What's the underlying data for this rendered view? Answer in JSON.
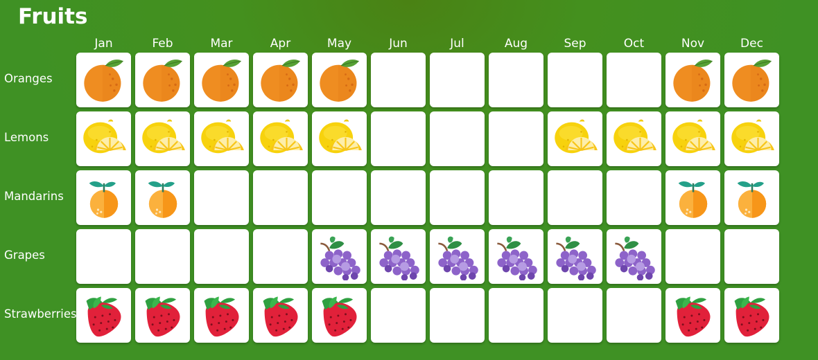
{
  "title": "Fruits",
  "months": [
    "Jan",
    "Feb",
    "Mar",
    "Apr",
    "May",
    "Jun",
    "Jul",
    "Aug",
    "Sep",
    "Oct",
    "Nov",
    "Dec"
  ],
  "fruits": [
    {
      "name": "Oranges",
      "icon": "orange-icon",
      "availability": [
        true,
        true,
        true,
        true,
        true,
        false,
        false,
        false,
        false,
        false,
        true,
        true
      ]
    },
    {
      "name": "Lemons",
      "icon": "lemon-icon",
      "availability": [
        true,
        true,
        true,
        true,
        true,
        false,
        false,
        false,
        true,
        true,
        true,
        true
      ]
    },
    {
      "name": "Mandarins",
      "icon": "mandarin-icon",
      "availability": [
        true,
        true,
        false,
        false,
        false,
        false,
        false,
        false,
        false,
        false,
        true,
        true
      ]
    },
    {
      "name": "Grapes",
      "icon": "grapes-icon",
      "availability": [
        false,
        false,
        false,
        false,
        true,
        true,
        true,
        true,
        true,
        true,
        false,
        false
      ]
    },
    {
      "name": "Strawberries",
      "icon": "strawberry-icon",
      "availability": [
        true,
        true,
        true,
        true,
        true,
        false,
        false,
        false,
        false,
        false,
        true,
        true
      ]
    }
  ]
}
